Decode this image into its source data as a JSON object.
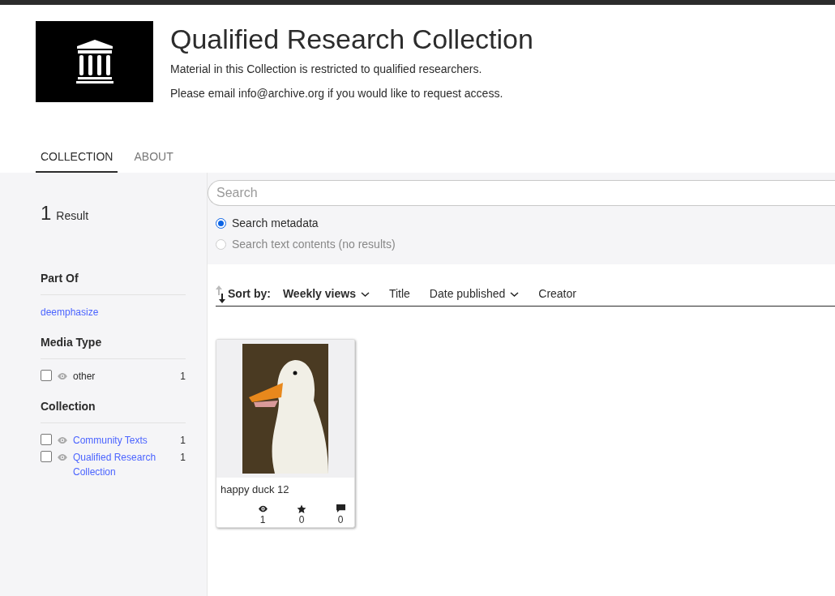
{
  "header": {
    "title": "Qualified Research Collection",
    "lines": [
      "Material in this Collection is restricted to qualified researchers.",
      "Please email info@archive.org if you would like to request access."
    ]
  },
  "tabs": [
    {
      "label": "COLLECTION",
      "selected": true
    },
    {
      "label": "ABOUT",
      "selected": false
    }
  ],
  "results": {
    "count": "1",
    "label": "Result"
  },
  "search": {
    "placeholder": "Search",
    "options": [
      {
        "label": "Search metadata",
        "selected": true,
        "disabled": false
      },
      {
        "label": "Search text contents (no results)",
        "selected": false,
        "disabled": true
      }
    ]
  },
  "facets": [
    {
      "title": "Part Of",
      "items": [
        {
          "kind": "link",
          "label": "deemphasize"
        }
      ]
    },
    {
      "title": "Media Type",
      "items": [
        {
          "kind": "checkbox",
          "label": "other",
          "link": false,
          "count": "1",
          "checked": false
        }
      ]
    },
    {
      "title": "Collection",
      "items": [
        {
          "kind": "checkbox",
          "label": "Community Texts",
          "link": true,
          "count": "1",
          "checked": false
        },
        {
          "kind": "checkbox",
          "label": "Qualified Research Collection",
          "link": true,
          "count": "1",
          "checked": false
        }
      ]
    }
  ],
  "sort": {
    "label": "Sort by:",
    "options": [
      {
        "label": "Weekly views",
        "selected": true,
        "dropdown": true
      },
      {
        "label": "Title",
        "selected": false,
        "dropdown": false
      },
      {
        "label": "Date published",
        "selected": false,
        "dropdown": true
      },
      {
        "label": "Creator",
        "selected": false,
        "dropdown": false
      }
    ]
  },
  "items": [
    {
      "title": "happy duck 12",
      "stats": [
        {
          "kind": "views",
          "value": "1"
        },
        {
          "kind": "favorites",
          "value": "0"
        },
        {
          "kind": "reviews",
          "value": "0"
        }
      ]
    }
  ]
}
